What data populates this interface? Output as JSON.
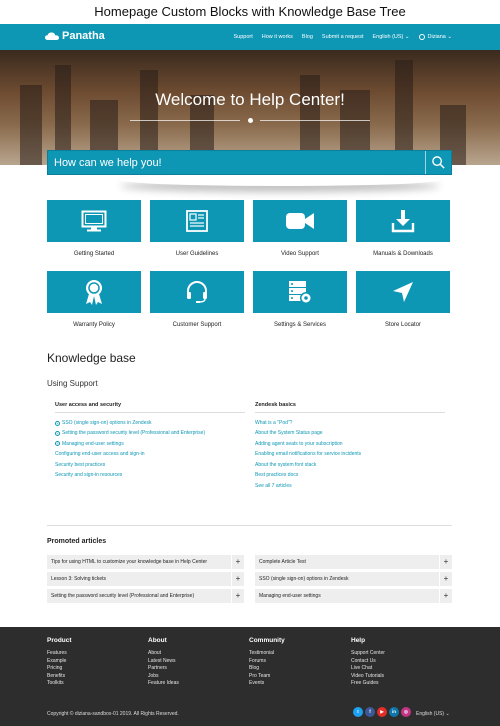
{
  "page_header": {
    "title": "Homepage Custom Blocks with Knowledge Base Tree"
  },
  "nav": {
    "brand": "Panatha",
    "links": [
      "Support",
      "How it works",
      "Blog",
      "Submit a request",
      "English (US) ⌄"
    ],
    "user": "Diziana ⌄"
  },
  "hero": {
    "title": "Welcome to Help Center!"
  },
  "search": {
    "placeholder": "How can we help you!"
  },
  "blocks": [
    {
      "label": "Getting Started",
      "icon": "monitor-icon"
    },
    {
      "label": "User Guidelines",
      "icon": "newspaper-icon"
    },
    {
      "label": "Video Support",
      "icon": "video-camera-icon"
    },
    {
      "label": "Manuals & Downloads",
      "icon": "download-icon"
    },
    {
      "label": "Warranty Policy",
      "icon": "award-ribbon-icon"
    },
    {
      "label": "Customer Support",
      "icon": "headset-icon"
    },
    {
      "label": "Settings & Services",
      "icon": "server-gear-icon"
    },
    {
      "label": "Store Locator",
      "icon": "location-arrow-icon"
    }
  ],
  "knowledge_base": {
    "title": "Knowledge base",
    "category": "Using Support",
    "sections": [
      {
        "title": "User access and security",
        "articles": [
          {
            "text": "SSO (single sign-on) options in Zendesk",
            "expand": true
          },
          {
            "text": "Setting the password security level (Professional and Enterprise)",
            "expand": true
          },
          {
            "text": "Managing end-user settings",
            "expand": true
          },
          {
            "text": "Configuring end-user access and sign-in",
            "expand": false
          },
          {
            "text": "Security best practices",
            "expand": false
          },
          {
            "text": "Security and sign-in resources",
            "expand": false
          }
        ]
      },
      {
        "title": "Zendesk basics",
        "articles": [
          {
            "text": "What is a \"Pod\"?",
            "expand": false
          },
          {
            "text": "About the System Status page",
            "expand": false
          },
          {
            "text": "Adding agent seats to your subscription",
            "expand": false
          },
          {
            "text": "Enabling email notifications for service incidents",
            "expand": false
          },
          {
            "text": "About the system font stack",
            "expand": false
          },
          {
            "text": "Best practices docs",
            "expand": false
          }
        ],
        "see_all": "See all 7 articles"
      }
    ]
  },
  "promoted": {
    "title": "Promoted articles",
    "items": [
      "Tips for using HTML to customize your knowledge base in Help Center",
      "Complete Article Test",
      "Lesson 3: Solving tickets",
      "SSO (single sign-on) options in Zendesk",
      "Setting the password security level (Professional and Enterprise)",
      "Managing end-user settings"
    ],
    "expand_label": "+"
  },
  "footer": {
    "columns": [
      {
        "title": "Product",
        "links": [
          "Features",
          "Example",
          "Pricing",
          "Benefits",
          "Toolkits"
        ]
      },
      {
        "title": "About",
        "links": [
          "About",
          "Latest News",
          "Partners",
          "Jobs",
          "Feature Ideas"
        ]
      },
      {
        "title": "Community",
        "links": [
          "Testimonial",
          "Forums",
          "Blog",
          "Pro Team",
          "Events"
        ]
      },
      {
        "title": "Help",
        "links": [
          "Support Center",
          "Contact Us",
          "Live Chat",
          "Video Tutorials",
          "Free Guides"
        ]
      }
    ],
    "copyright": "Copyright © diziana-sandbox-01 2019. All Rights Reserved.",
    "social": [
      {
        "name": "twitter",
        "glyph": "t",
        "color": "#1da1f2"
      },
      {
        "name": "facebook",
        "glyph": "f",
        "color": "#3b5998"
      },
      {
        "name": "youtube",
        "glyph": "▶",
        "color": "#e52d27"
      },
      {
        "name": "linkedin",
        "glyph": "in",
        "color": "#0e76a8"
      },
      {
        "name": "instagram",
        "glyph": "◎",
        "color": "#c13584"
      }
    ],
    "language": "English (US) ⌄"
  },
  "colors": {
    "accent": "#0e97b5",
    "footer_bg": "#2d2d2d",
    "promo_bg": "#eeeeee"
  }
}
